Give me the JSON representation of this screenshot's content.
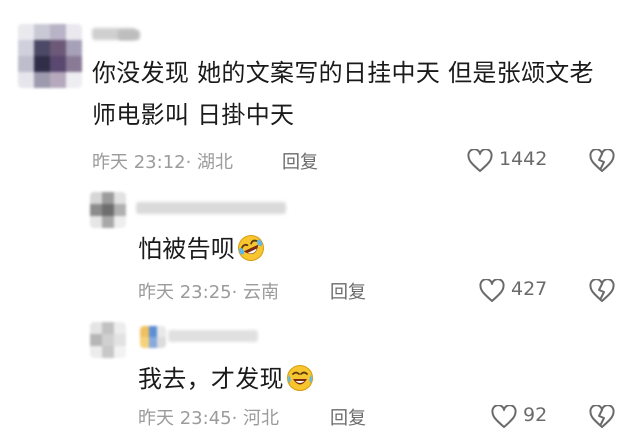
{
  "comments": [
    {
      "text_line1": "你没发现 她的文案写的日挂中天 但是张颂文老",
      "text_line2": "师电影叫 日掛中天",
      "time": "昨天 23:12",
      "location": "· 湖北",
      "reply_label": "回复",
      "likes": "1442",
      "icons": [
        "heart-outline-icon",
        "broken-heart-icon"
      ]
    },
    {
      "text": "怕被告呗",
      "emoji": "rofl-emoji",
      "time": "昨天 23:25",
      "location": "· 云南",
      "reply_label": "回复",
      "likes": "427",
      "icons": [
        "heart-outline-icon",
        "broken-heart-icon"
      ]
    },
    {
      "text": "我去，才发现",
      "emoji": "crying-laughing-emoji",
      "time": "昨天 23:45",
      "location": "· 河北",
      "reply_label": "回复",
      "likes": "92",
      "icons": [
        "heart-outline-icon",
        "broken-heart-icon"
      ]
    }
  ],
  "colors": {
    "text": "#1a1a1a",
    "meta": "#9b9b9b",
    "reply": "#6b6b6b",
    "icon": "#6a6a6a",
    "emoji_face": "#f7c52e"
  }
}
